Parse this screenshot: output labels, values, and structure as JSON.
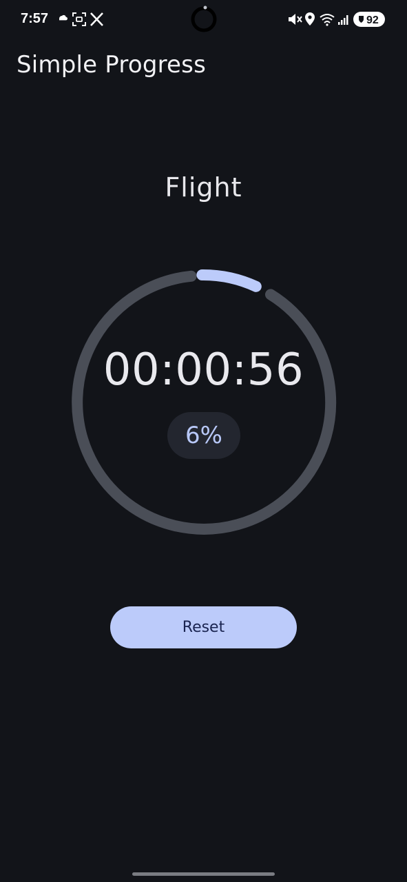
{
  "status_bar": {
    "time": "7:57",
    "battery": "92",
    "left_icons": [
      "cloud-icon",
      "screenshot-icon",
      "x-logo-icon"
    ],
    "right_icons": [
      "mute-icon",
      "location-icon",
      "wifi-icon",
      "signal-icon",
      "battery-icon"
    ]
  },
  "app": {
    "title": "Simple Progress"
  },
  "timer": {
    "name": "Flight",
    "elapsed": "00:00:56",
    "percent_label": "6%",
    "progress_fraction": 0.06
  },
  "actions": {
    "reset_label": "Reset"
  },
  "colors": {
    "background": "#121419",
    "track": "#4a4e57",
    "progress": "#bccbfa",
    "button": "#bccbfa",
    "button_text": "#1a2450"
  }
}
